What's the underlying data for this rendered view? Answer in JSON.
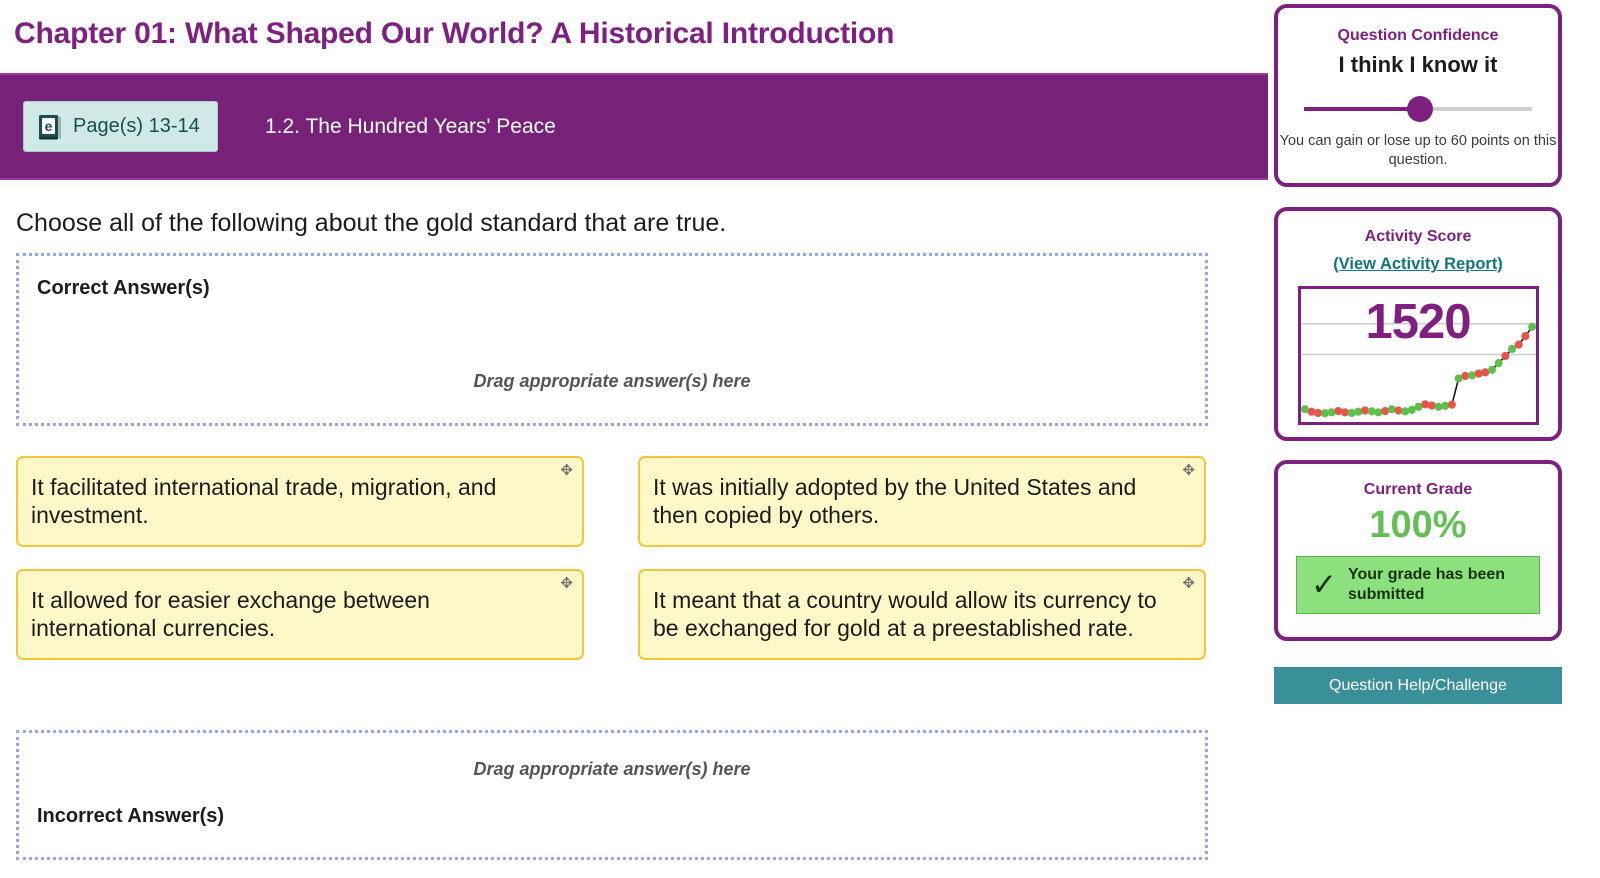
{
  "header": {
    "chapter_title": "Chapter 01: What Shaped Our World? A Historical Introduction",
    "page_badge_label": "Page(s) 13-14",
    "page_badge_icon": "ebook-icon",
    "section_label": "1.2. The Hundred Years' Peace"
  },
  "question": {
    "prompt": "Choose all of the following about the gold standard that are true.",
    "correct_zone_label": "Correct Answer(s)",
    "incorrect_zone_label": "Incorrect Answer(s)",
    "drop_hint": "Drag appropriate answer(s) here",
    "move_handle_icon": "move-arrows-icon",
    "answers": [
      "It facilitated international trade, migration, and investment.",
      "It was initially adopted by the United States and then copied by others.",
      "It allowed for easier exchange between international currencies.",
      "It meant that a country would allow its currency to be exchanged for gold at a preestablished rate."
    ]
  },
  "sidebar": {
    "confidence": {
      "title": "Question Confidence",
      "value_label": "I think I know it",
      "note": "You can gain or lose up to 60 points on this question.",
      "slider_percent": 51
    },
    "activity": {
      "title": "Activity Score",
      "link_label": "(View Activity Report)",
      "score": "1520"
    },
    "grade": {
      "title": "Current Grade",
      "value": "100%",
      "badge_text": "Your grade has been submitted",
      "badge_icon": "check-icon"
    },
    "help_button_label": "Question Help/Challenge"
  },
  "colors": {
    "brand_purple": "#7d2080",
    "header_bar": "#772178",
    "teal": "#3a9099",
    "card_yellow": "#fdf8c8",
    "card_border": "#f0c63c",
    "dropzone_border": "#97a6e8",
    "grade_green": "#64c055",
    "badge_green": "#8ce07d",
    "spark_green": "#5cc04a",
    "spark_red": "#e8544a"
  },
  "chart_data": {
    "type": "line",
    "title": "Activity Score",
    "xlabel": "",
    "ylabel": "",
    "grid": true,
    "gridlines_y": [
      2,
      3
    ],
    "legend": "none",
    "ylim": [
      0,
      4
    ],
    "current_value": 1520,
    "x": [
      0,
      1,
      2,
      3,
      4,
      5,
      6,
      7,
      8,
      9,
      10,
      11,
      12,
      13,
      14,
      15,
      16,
      17,
      18,
      19,
      20,
      21,
      22,
      23,
      24,
      25,
      26,
      27,
      28,
      29,
      30,
      31,
      32,
      33,
      34
    ],
    "values": [
      0.22,
      0.14,
      0.1,
      0.09,
      0.12,
      0.16,
      0.12,
      0.1,
      0.14,
      0.18,
      0.15,
      0.12,
      0.16,
      0.22,
      0.18,
      0.15,
      0.2,
      0.3,
      0.38,
      0.34,
      0.3,
      0.33,
      0.37,
      1.22,
      1.3,
      1.32,
      1.38,
      1.42,
      1.5,
      1.72,
      1.95,
      2.18,
      2.32,
      2.6,
      2.9
    ],
    "point_colors": [
      "green",
      "red",
      "red",
      "green",
      "green",
      "red",
      "red",
      "green",
      "green",
      "red",
      "green",
      "green",
      "red",
      "green",
      "red",
      "green",
      "green",
      "green",
      "red",
      "red",
      "green",
      "green",
      "red",
      "green",
      "red",
      "green",
      "red",
      "red",
      "green",
      "green",
      "red",
      "green",
      "red",
      "red",
      "green"
    ]
  }
}
